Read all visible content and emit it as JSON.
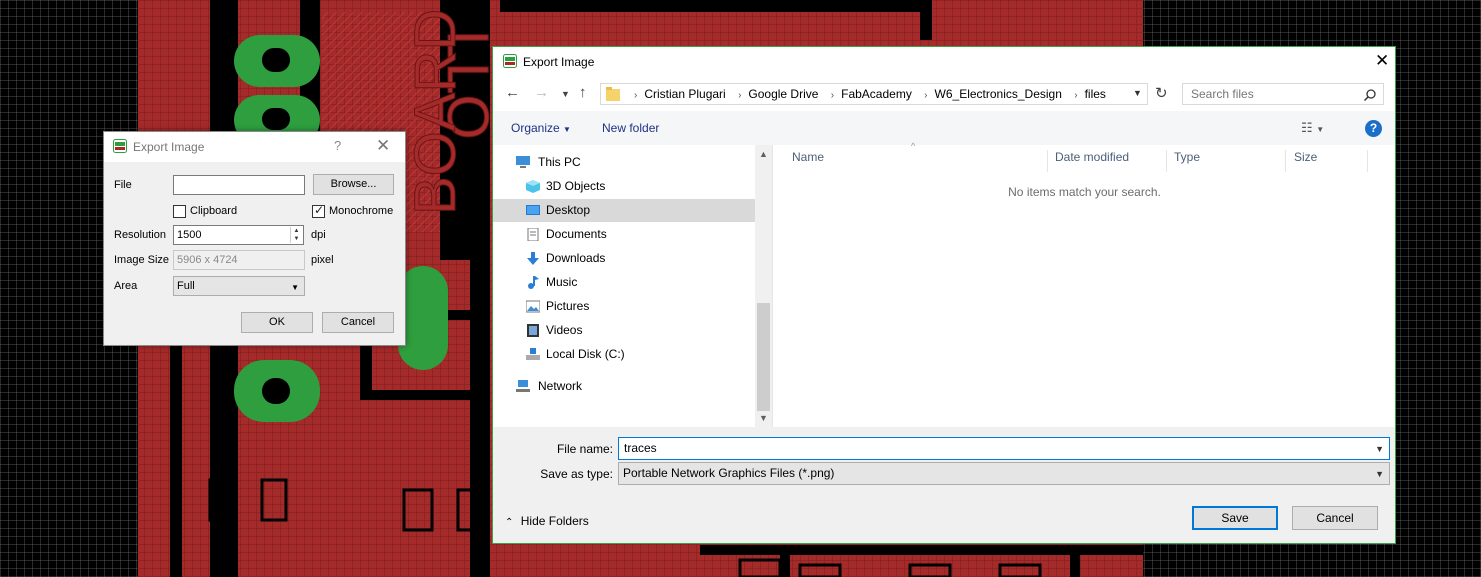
{
  "eagle_dialog": {
    "title": "Export Image",
    "help": "?",
    "close": "✕",
    "file_label": "File",
    "file_value": "",
    "browse_label": "Browse...",
    "clipboard_label": "Clipboard",
    "clipboard_checked": false,
    "monochrome_label": "Monochrome",
    "monochrome_checked": true,
    "resolution_label": "Resolution",
    "resolution_value": "1500",
    "resolution_unit": "dpi",
    "image_size_label": "Image Size",
    "image_size_value": "5906 x 4724",
    "image_size_unit": "pixel",
    "area_label": "Area",
    "area_value": "Full",
    "ok_label": "OK",
    "cancel_label": "Cancel"
  },
  "pcb_text": [
    "LLO",
    "BOARD"
  ],
  "save_dialog": {
    "title": "Export Image",
    "close": "✕",
    "breadcrumbs": [
      "Cristian Plugari",
      "Google Drive",
      "FabAcademy",
      "W6_Electronics_Design",
      "files"
    ],
    "search_placeholder": "Search files",
    "toolbar": {
      "organize": "Organize",
      "new_folder": "New folder"
    },
    "nav_items": [
      {
        "label": "This PC",
        "icon": "computer-icon",
        "level": 0,
        "selected": false
      },
      {
        "label": "3D Objects",
        "icon": "cube-icon",
        "level": 1,
        "selected": false
      },
      {
        "label": "Desktop",
        "icon": "desktop-icon",
        "level": 1,
        "selected": true
      },
      {
        "label": "Documents",
        "icon": "document-icon",
        "level": 1,
        "selected": false
      },
      {
        "label": "Downloads",
        "icon": "download-icon",
        "level": 1,
        "selected": false
      },
      {
        "label": "Music",
        "icon": "music-icon",
        "level": 1,
        "selected": false
      },
      {
        "label": "Pictures",
        "icon": "pictures-icon",
        "level": 1,
        "selected": false
      },
      {
        "label": "Videos",
        "icon": "video-icon",
        "level": 1,
        "selected": false
      },
      {
        "label": "Local Disk (C:)",
        "icon": "disk-icon",
        "level": 1,
        "selected": false
      },
      {
        "label": "Network",
        "icon": "network-icon",
        "level": 0,
        "selected": false
      }
    ],
    "columns": [
      "Name",
      "Date modified",
      "Type",
      "Size"
    ],
    "empty_message": "No items match your search.",
    "file_name_label": "File name:",
    "file_name_value": "traces",
    "save_as_type_label": "Save as type:",
    "save_as_type_value": "Portable Network Graphics Files (*.png)",
    "hide_folders_label": "Hide Folders",
    "save_label": "Save",
    "cancel_label": "Cancel"
  },
  "colors": {
    "pcb_red": "#a52a2a",
    "pad_green": "#2e9e3e",
    "accent_blue": "#0078d7",
    "save_border": "#3aa04a"
  }
}
